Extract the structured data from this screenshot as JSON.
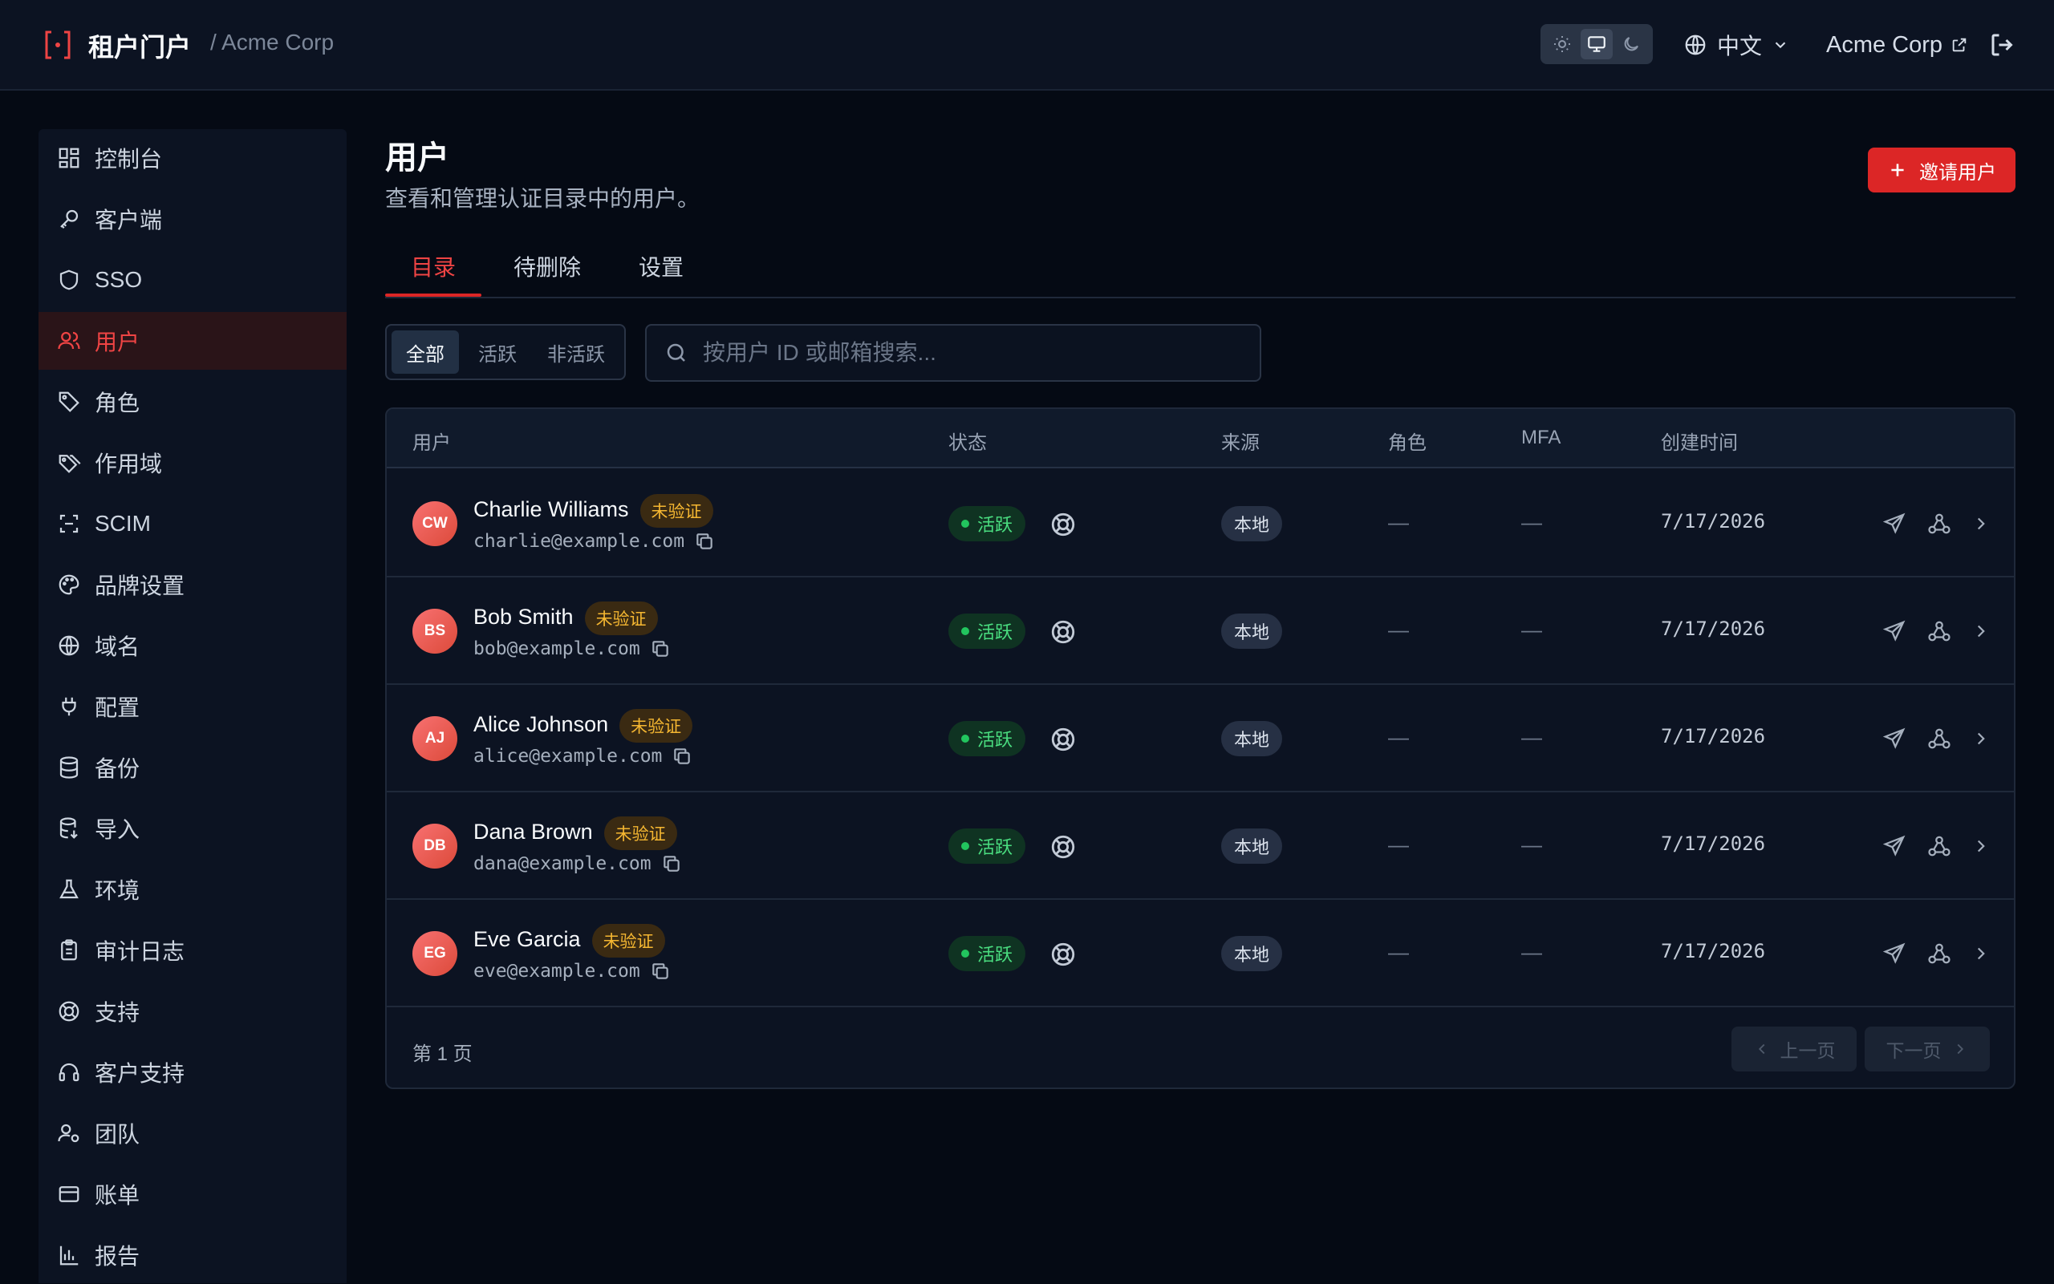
{
  "header": {
    "title": "租户门户",
    "org_crumb": "/ Acme Corp",
    "theme_modes": [
      "sun-icon",
      "monitor-icon",
      "moon-icon"
    ],
    "theme_active": "system",
    "language": "中文",
    "org_link": "Acme Corp"
  },
  "sidebar": {
    "items": [
      {
        "label": "控制台",
        "icon": "dashboard-icon"
      },
      {
        "label": "客户端",
        "icon": "key-icon"
      },
      {
        "label": "SSO",
        "icon": "shield-icon"
      },
      {
        "label": "用户",
        "icon": "users-icon",
        "active": true
      },
      {
        "label": "角色",
        "icon": "tag-icon"
      },
      {
        "label": "作用域",
        "icon": "tags-icon"
      },
      {
        "label": "SCIM",
        "icon": "scan-icon"
      },
      {
        "label": "品牌设置",
        "icon": "palette-icon"
      },
      {
        "label": "域名",
        "icon": "globe-icon"
      },
      {
        "label": "配置",
        "icon": "plug-icon"
      },
      {
        "label": "备份",
        "icon": "database-icon"
      },
      {
        "label": "导入",
        "icon": "database-import-icon"
      },
      {
        "label": "环境",
        "icon": "flask-icon"
      },
      {
        "label": "审计日志",
        "icon": "clipboard-icon"
      },
      {
        "label": "支持",
        "icon": "lifebuoy-icon"
      },
      {
        "label": "客户支持",
        "icon": "headset-icon"
      },
      {
        "label": "团队",
        "icon": "user-gear-icon"
      },
      {
        "label": "账单",
        "icon": "credit-card-icon"
      },
      {
        "label": "报告",
        "icon": "bar-chart-icon"
      }
    ]
  },
  "main": {
    "title": "用户",
    "subtitle": "查看和管理认证目录中的用户。",
    "invite_label": "邀请用户",
    "tabs": [
      "目录",
      "待删除",
      "设置"
    ],
    "filters": [
      "全部",
      "活跃",
      "非活跃"
    ],
    "search": {
      "placeholder": "按用户 ID 或邮箱搜索...",
      "value": ""
    }
  },
  "table": {
    "columns": [
      "用户",
      "状态",
      "来源",
      "角色",
      "MFA",
      "创建时间"
    ],
    "rows": [
      {
        "initials": "CW",
        "name": "Charlie Williams",
        "badge": "未验证",
        "email": "charlie@example.com",
        "status": "活跃",
        "source": "本地",
        "roles": "—",
        "mfa": "—",
        "created": "7/17/2026"
      },
      {
        "initials": "BS",
        "name": "Bob Smith",
        "badge": "未验证",
        "email": "bob@example.com",
        "status": "活跃",
        "source": "本地",
        "roles": "—",
        "mfa": "—",
        "created": "7/17/2026"
      },
      {
        "initials": "AJ",
        "name": "Alice Johnson",
        "badge": "未验证",
        "email": "alice@example.com",
        "status": "活跃",
        "source": "本地",
        "roles": "—",
        "mfa": "—",
        "created": "7/17/2026"
      },
      {
        "initials": "DB",
        "name": "Dana Brown",
        "badge": "未验证",
        "email": "dana@example.com",
        "status": "活跃",
        "source": "本地",
        "roles": "—",
        "mfa": "—",
        "created": "7/17/2026"
      },
      {
        "initials": "EG",
        "name": "Eve Garcia",
        "badge": "未验证",
        "email": "eve@example.com",
        "status": "活跃",
        "source": "本地",
        "roles": "—",
        "mfa": "—",
        "created": "7/17/2026"
      }
    ],
    "page_info": "第 1 页",
    "prev_label": "上一页",
    "next_label": "下一页"
  },
  "colors": {
    "accent": "#dc2626",
    "background": "#050a14",
    "panel": "#0c1322",
    "active_status": "#22c55e",
    "unverified": "#f5b731"
  }
}
